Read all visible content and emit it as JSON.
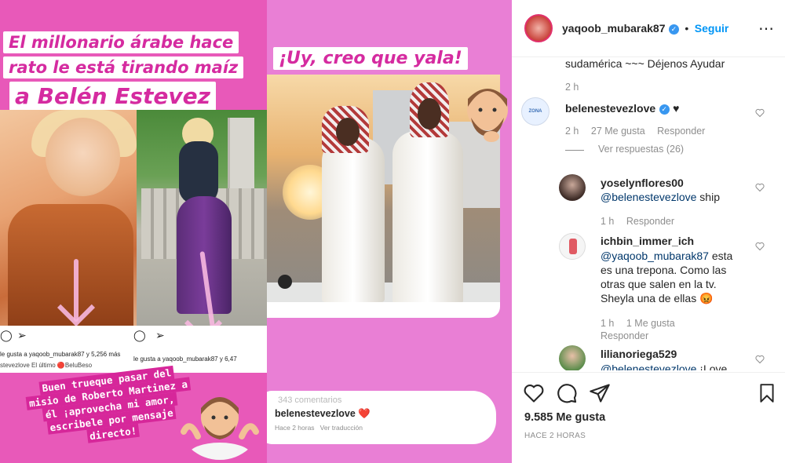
{
  "story_left": {
    "headline": [
      "El millonario árabe hace",
      "rato le está tirando maíz",
      "a Belén Estevez"
    ],
    "post_left_likes": "le gusta a yaqoob_mubarak87 y 5,256 más",
    "post_left_caption": "stevezlove El último 🔴BeluBeso",
    "post_right_likes": "le gusta a yaqoob_mubarak87 y 6,47",
    "caption_lines": [
      "Buen trueque pasar del",
      "misio de Roberto Martinez a",
      "él ¡aprovecha mi amor,",
      "escribele por mensaje",
      "directo!"
    ]
  },
  "story_mid": {
    "headline": "¡Uy, creo que yala!",
    "comments_count": "343 comentarios",
    "comment_user": "belenestevezlove",
    "comment_heart": "❤️",
    "comment_time": "Hace 2 horas",
    "comment_translate": "Ver traducción"
  },
  "instagram": {
    "header": {
      "username": "yaqoob_mubarak87",
      "verified": "✓",
      "separator": "•",
      "follow_label": "Seguir",
      "more_icon": "⋯"
    },
    "caption_tail": "sudamérica ~~~ Déjenos Ayudar",
    "caption_time": "2 h",
    "comments": [
      {
        "user": "belenestevezlove",
        "verified": "✓",
        "text": "♥",
        "time": "2 h",
        "likes": "27 Me gusta",
        "reply": "Responder",
        "view_replies": "Ver respuestas (26)",
        "avatar_text": "ZONA PALFA"
      },
      {
        "user": "yoselynflores00",
        "mention": "@belenestevezlove",
        "text": " ship",
        "time": "1 h",
        "reply": "Responder"
      },
      {
        "user": "ichbin_immer_ich",
        "mention": "@yaqoob_mubarak87",
        "text_lines": [
          " esta",
          "es una trepona. Como las",
          "otras que salen en la tv.",
          "Sheyla una de ellas"
        ],
        "emoji": "😡",
        "time": "1 h",
        "likes": "1 Me gusta",
        "reply": "Responder"
      },
      {
        "user": "lilianoriega529",
        "mention": "@belenestevezlove",
        "text": " ¡Love"
      }
    ],
    "likes": "9.585 Me gusta",
    "posted": "HACE 2 HORAS",
    "colors": {
      "link": "#00376b",
      "verified": "#3897f0",
      "follow": "#0095f6",
      "meta": "#8e8e8e"
    }
  }
}
